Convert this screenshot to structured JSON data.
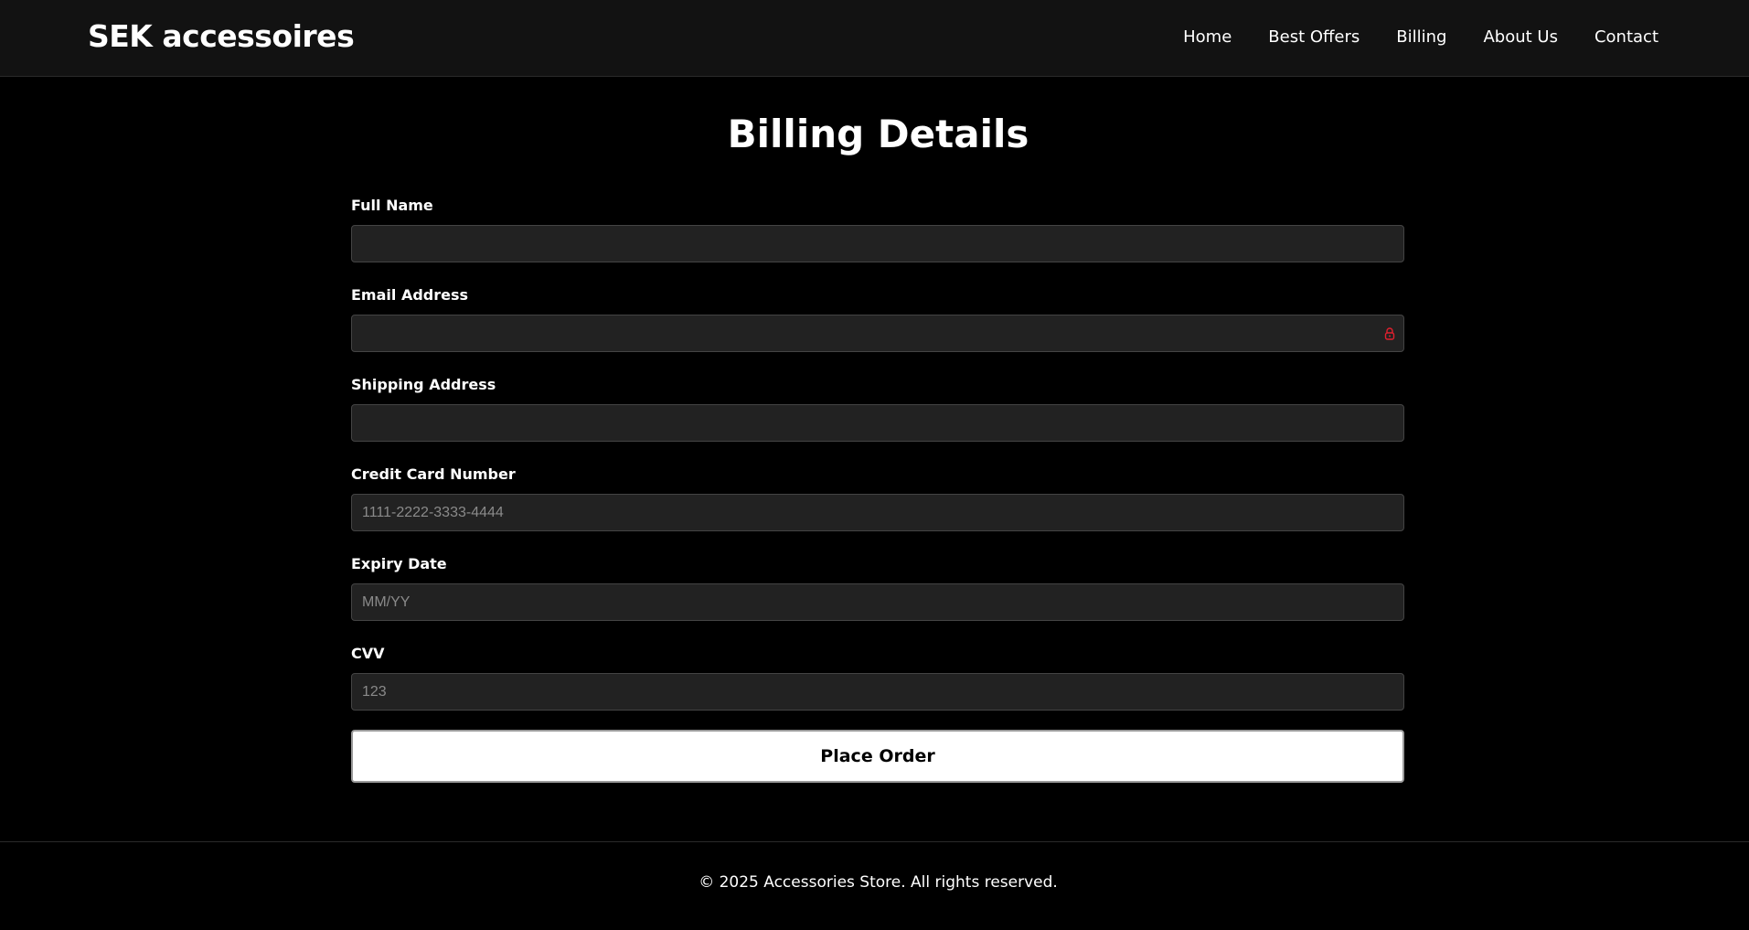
{
  "header": {
    "brand": "SEK accessoires",
    "nav": [
      {
        "label": "Home"
      },
      {
        "label": "Best Offers"
      },
      {
        "label": "Billing"
      },
      {
        "label": "About Us"
      },
      {
        "label": "Contact"
      }
    ]
  },
  "main": {
    "title": "Billing Details",
    "fields": [
      {
        "label": "Full Name",
        "value": "",
        "placeholder": ""
      },
      {
        "label": "Email Address",
        "value": "",
        "placeholder": "",
        "icon": "lock-icon",
        "icon_color": "#e0202e"
      },
      {
        "label": "Shipping Address",
        "value": "",
        "placeholder": ""
      },
      {
        "label": "Credit Card Number",
        "value": "",
        "placeholder": "1111-2222-3333-4444"
      },
      {
        "label": "Expiry Date",
        "value": "",
        "placeholder": "MM/YY"
      },
      {
        "label": "CVV",
        "value": "",
        "placeholder": "123"
      }
    ],
    "submit_label": "Place Order"
  },
  "footer": {
    "text": "© 2025 Accessories Store. All rights reserved."
  },
  "colors": {
    "background": "#000000",
    "header_bg": "#121212",
    "input_bg": "#222222",
    "button_bg": "#ffffff",
    "accent_icon": "#e0202e"
  }
}
